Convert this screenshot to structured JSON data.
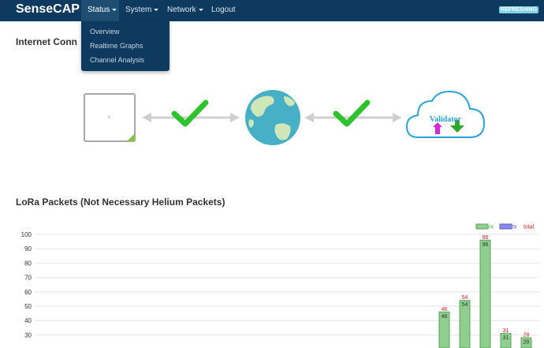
{
  "navbar": {
    "brand": "SenseCAP",
    "items": [
      {
        "label": "Status"
      },
      {
        "label": "System"
      },
      {
        "label": "Network"
      },
      {
        "label": "Logout"
      }
    ],
    "badge": "REFRESHING"
  },
  "dropdown": {
    "items": [
      "Overview",
      "Realtime Graphs",
      "Channel Analysis"
    ]
  },
  "internet": {
    "title": "Internet Conn",
    "gateway_glyph": "x",
    "validator_label": "Validator"
  },
  "lora": {
    "title": "LoRa Packets (Not Necessary Helium Packets)"
  },
  "colors": {
    "navbar": "#0d3a5e",
    "check": "#2ec22e",
    "rx": "#8fce8f",
    "tx": "#8a8ae8",
    "total": "#e02020"
  },
  "chart_data": {
    "type": "bar",
    "ylim": [
      20,
      100
    ],
    "yticks": [
      "100",
      "90",
      "80",
      "70",
      "60",
      "50",
      "40",
      "30"
    ],
    "legend": [
      "rx",
      "tx",
      "total"
    ],
    "legend_position": "top-right",
    "grid": true,
    "series": [
      {
        "name": "rx",
        "values": [
          46,
          54,
          96,
          31,
          28
        ]
      },
      {
        "name": "total",
        "values": [
          46,
          54,
          96,
          31,
          28
        ]
      }
    ]
  }
}
